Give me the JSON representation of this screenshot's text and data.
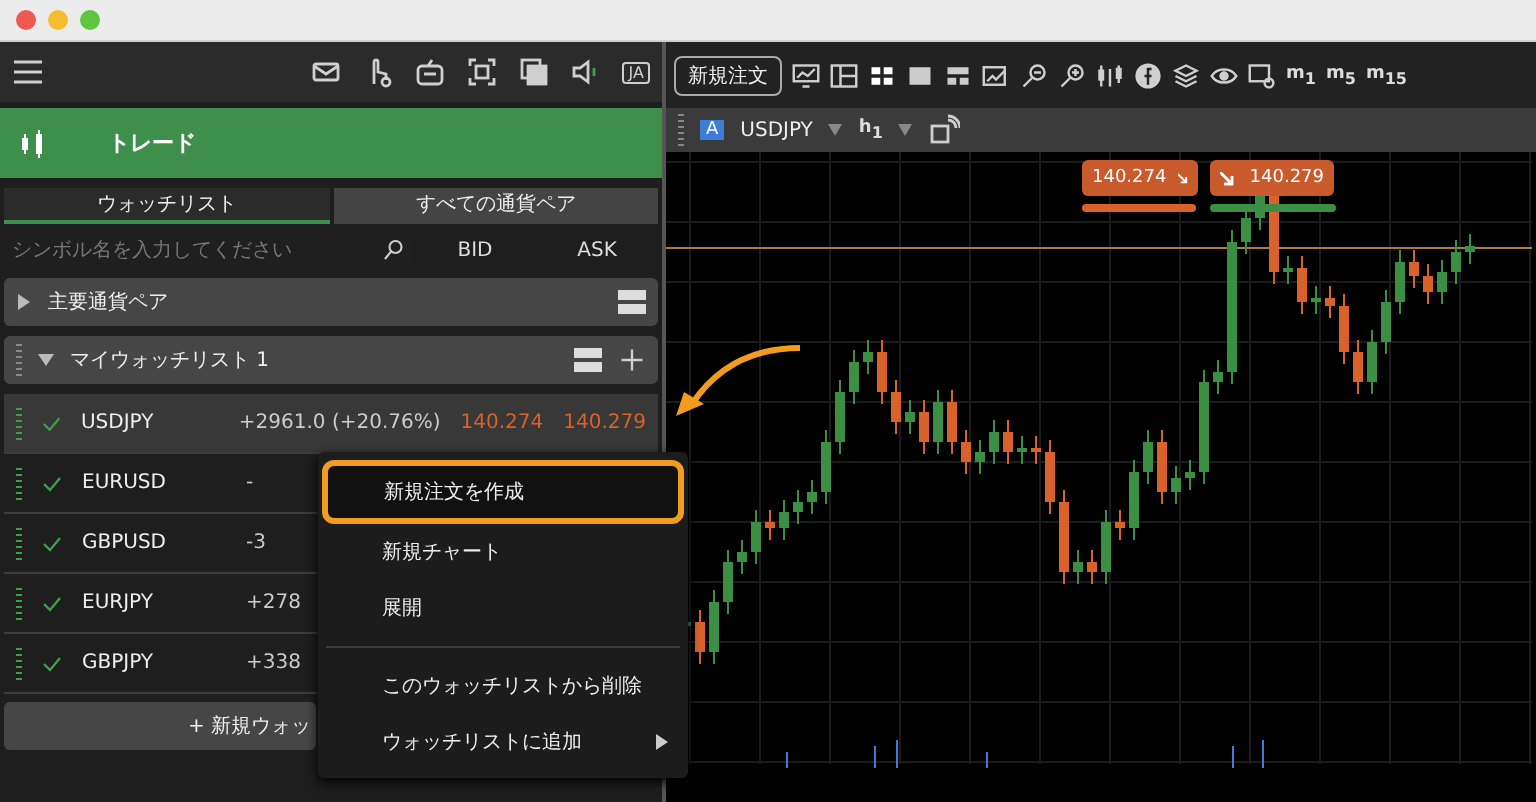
{
  "sidebar": {
    "language_badge": "JA",
    "section_title": "トレード",
    "tabs": [
      {
        "label": "ウォッチリスト",
        "selected": true
      },
      {
        "label": "すべての通貨ペア",
        "selected": false
      }
    ],
    "search": {
      "placeholder": "シンボル名を入力してください"
    },
    "columns": [
      "BID",
      "ASK"
    ],
    "groups": [
      {
        "name": "主要通貨ペア",
        "expanded": false
      },
      {
        "name": "マイウォッチリスト 1",
        "expanded": true,
        "rows": [
          {
            "symbol": "USDJPY",
            "change": "+2961.0 (+20.76%)",
            "bid": "140.274",
            "ask": "140.279",
            "selected": true
          },
          {
            "symbol": "EURUSD",
            "change": "-",
            "selected": false
          },
          {
            "symbol": "GBPUSD",
            "change": "-3",
            "selected": false
          },
          {
            "symbol": "EURJPY",
            "change": "+278",
            "selected": false
          },
          {
            "symbol": "GBPJPY",
            "change": "+338",
            "selected": false
          }
        ]
      }
    ],
    "new_watchlist_button": "+ 新規ウォッ"
  },
  "context_menu": {
    "items": [
      {
        "kind": "item",
        "label": "新規注文を作成",
        "selected": true,
        "submenu": false
      },
      {
        "kind": "item",
        "label": "新規チャート",
        "selected": false,
        "submenu": false
      },
      {
        "kind": "item",
        "label": "展開",
        "selected": false,
        "submenu": false
      },
      {
        "kind": "divider"
      },
      {
        "kind": "item",
        "label": "このウォッチリストから削除",
        "selected": false,
        "submenu": false
      },
      {
        "kind": "item",
        "label": "ウォッチリストに追加",
        "selected": false,
        "submenu": true
      }
    ]
  },
  "toolbar": {
    "new_order_button": "新規注文",
    "timeframes": [
      "m$_{1}$",
      "m$_{5}$",
      "m$_{15}$"
    ]
  },
  "chart": {
    "badge": "A",
    "symbol": "USDJPY",
    "timeframe": "h$_{1}$",
    "bid_price": "140.274",
    "ask_price": "140.279"
  }
}
